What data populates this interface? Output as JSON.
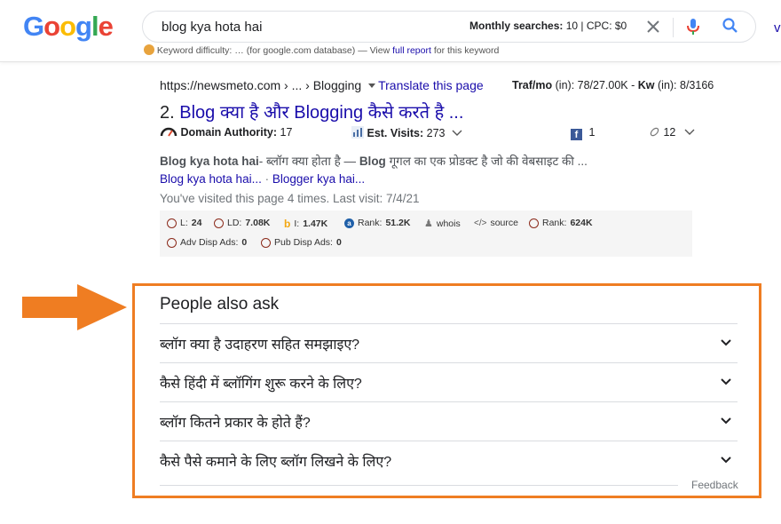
{
  "header": {
    "logo": [
      "G",
      "o",
      "o",
      "g",
      "l",
      "e"
    ],
    "logo_colors": [
      "#4285F4",
      "#EA4335",
      "#FBBC05",
      "#4285F4",
      "#34A853",
      "#EA4335"
    ],
    "search_value": "blog kya hota hai",
    "monthly_label": "Monthly searches:",
    "monthly_value": "10 | CPC: $0",
    "right_cut_text": "v",
    "kd_label": "Keyword difficulty:",
    "kd_dots": "…",
    "kd_text": "(for google.com database) — View",
    "kd_link": "full report",
    "kd_tail": "for this keyword"
  },
  "result": {
    "url": "https://newsmeto.com › ... › Blogging",
    "translate": "Translate this page",
    "traf_label": "Traf/mo",
    "traf_text": "(in): 78/27.00K -",
    "kw_label": "Kw",
    "kw_text": "(in): 8/3166",
    "number": "2.",
    "title": "Blog क्या है और Blogging कैसे करते है ...",
    "da_label": "Domain Authority:",
    "da_value": "17",
    "visits_label": "Est. Visits:",
    "visits_value": "273",
    "fb_count": "1",
    "links_count": "12",
    "snippet_bold": "Blog kya hota hai",
    "snippet_rest": "- ब्लॉग क्या होता है —",
    "snippet_bold2": "Blog",
    "snippet_rest2": "गूगल का एक प्रोडक्ट है जो की वेबसाइट की ...",
    "sitelink1": "Blog kya hota hai...",
    "sitelink_sep": "·",
    "sitelink2": "Blogger kya hai...",
    "visited": "You've visited this page 4 times. Last visit: 7/4/21"
  },
  "seo": {
    "l_label": "L:",
    "l_value": "24",
    "ld_label": "LD:",
    "ld_value": "7.08K",
    "i_label": "I:",
    "i_value": "1.47K",
    "rank_label": "Rank:",
    "rank_value": "51.2K",
    "whois": "whois",
    "source": "source",
    "rank2_label": "Rank:",
    "rank2_value": "624K",
    "adv_label": "Adv Disp Ads:",
    "adv_value": "0",
    "pub_label": "Pub Disp Ads:",
    "pub_value": "0"
  },
  "paa": {
    "title": "People also ask",
    "questions": [
      "ब्लॉग क्या है उदाहरण सहित समझाइए?",
      "कैसे हिंदी में ब्लॉगिंग शुरू करने के लिए?",
      "ब्लॉग कितने प्रकार के होते हैं?",
      "कैसे पैसे कमाने के लिए ब्लॉग लिखने के लिए?"
    ],
    "feedback": "Feedback"
  },
  "colors": {
    "link": "#1a0dab",
    "highlight_orange": "#ef7d22",
    "facebook": "#3b5998"
  }
}
